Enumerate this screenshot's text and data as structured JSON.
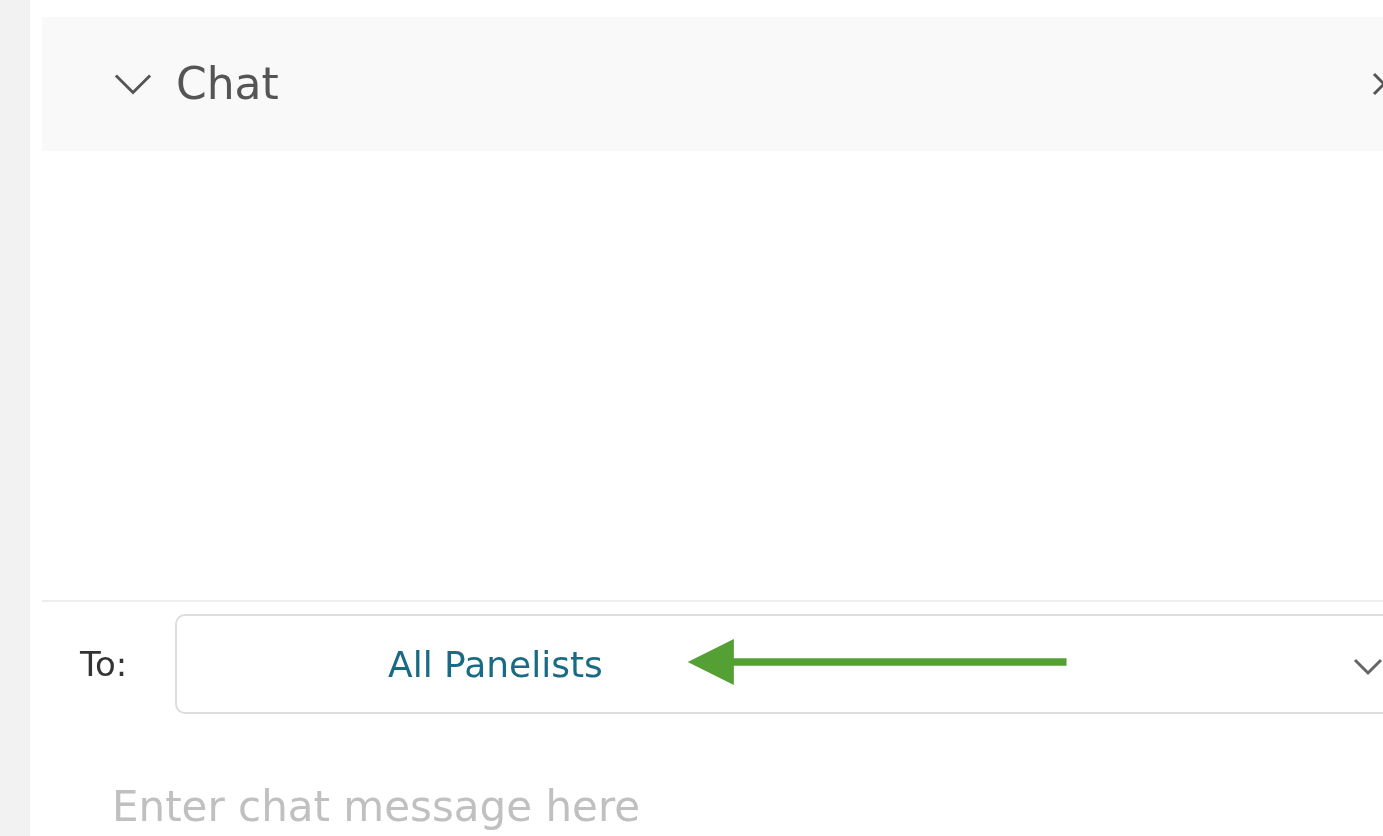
{
  "panel": {
    "title": "Chat",
    "expanded": true
  },
  "recipient": {
    "label": "To:",
    "value": "All Panelists"
  },
  "message": {
    "placeholder": "Enter chat message here"
  }
}
